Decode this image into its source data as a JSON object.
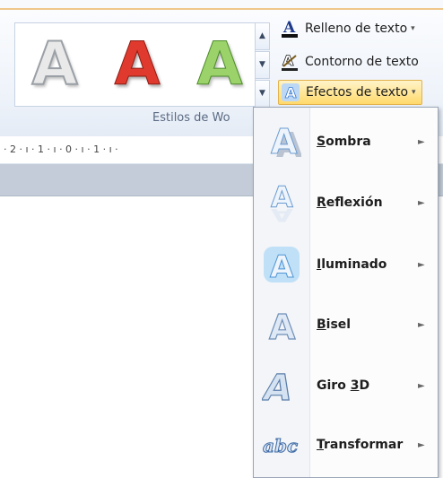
{
  "ribbon": {
    "gallery_styles": [
      {
        "glyph": "A",
        "name": "silver-style"
      },
      {
        "glyph": "A",
        "name": "red-style"
      },
      {
        "glyph": "A",
        "name": "green-style"
      }
    ],
    "scroll": {
      "up": "▲",
      "down": "▼",
      "more": "▼"
    },
    "buttons": {
      "fill": "Relleno de texto",
      "outline": "Contorno de texto",
      "effects": "Efectos de texto",
      "dropdown_arrow": "▾"
    },
    "group_label": "Estilos de Wo"
  },
  "ruler": {
    "text": "· 2 · ı · 1 · ı · 0 · ı · 1 · ı ·"
  },
  "effects_menu": {
    "items": [
      {
        "label": "Sombra",
        "mnemonic": "S",
        "rest": "ombra",
        "icon": "shadow-icon"
      },
      {
        "label": "Reflexión",
        "mnemonic": "R",
        "rest": "eflexión",
        "icon": "reflection-icon"
      },
      {
        "label": "Iluminado",
        "mnemonic": "I",
        "rest": "luminado",
        "icon": "glow-icon"
      },
      {
        "label": "Bisel",
        "mnemonic": "B",
        "rest": "isel",
        "icon": "bevel-icon"
      },
      {
        "label": "Giro 3D",
        "mnemonic": "3",
        "pre": "Giro ",
        "rest": "D",
        "icon": "rotation-3d-icon"
      },
      {
        "label": "Transformar",
        "mnemonic": "T",
        "rest": "ransformar",
        "icon": "transform-icon"
      }
    ],
    "submenu_arrow": "►"
  },
  "colors": {
    "accent_orange": "#f0c68a",
    "active_button": "#ffd96b",
    "menu_border": "#9aa6b8"
  }
}
